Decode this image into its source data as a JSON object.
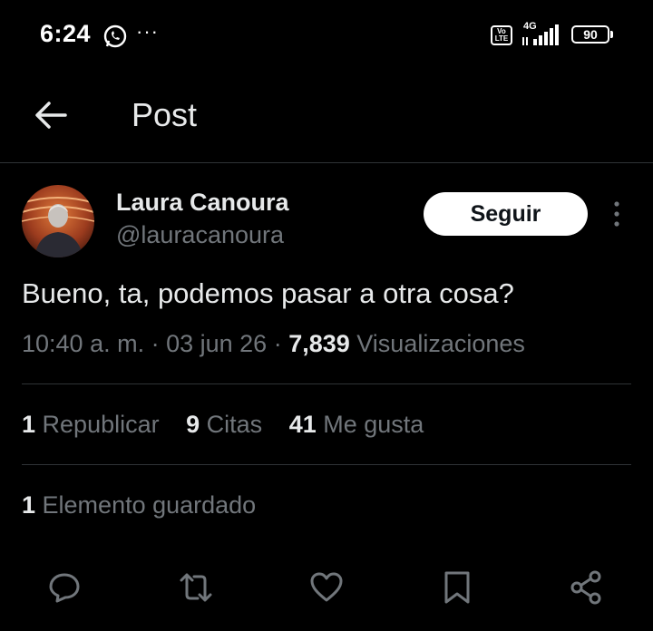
{
  "status_bar": {
    "time": "6:24",
    "more": "···",
    "volte": "Vo LTE",
    "network": "4G",
    "battery": "90"
  },
  "header": {
    "title": "Post",
    "back_icon": "arrow-left-icon"
  },
  "post": {
    "author_name": "Laura Canoura",
    "author_handle": "@lauracanoura",
    "follow_label": "Seguir",
    "text": "Bueno, ta, podemos pasar a otra cosa?",
    "time": "10:40 a. m.",
    "sep1": " · ",
    "date": "03 jun 26",
    "sep2": " · ",
    "views_count": "7,839",
    "views_label": " Visualizaciones"
  },
  "stats": {
    "reposts_count": "1",
    "reposts_label": " Republicar",
    "quotes_count": "9",
    "quotes_label": " Citas",
    "likes_count": "41",
    "likes_label": " Me gusta",
    "bookmarks_count": "1",
    "bookmarks_label": " Elemento guardado"
  },
  "actions": [
    "reply-icon",
    "repost-icon",
    "like-icon",
    "bookmark-icon",
    "share-icon"
  ],
  "colors": {
    "background": "#000000",
    "text_primary": "#e7e9ea",
    "text_secondary": "#71767b",
    "divider": "#2f3336",
    "follow_bg": "#ffffff"
  }
}
